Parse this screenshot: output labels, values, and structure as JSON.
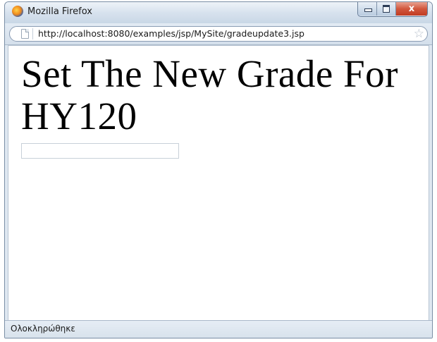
{
  "window": {
    "title": "Mozilla Firefox",
    "icon": "firefox-logo-icon",
    "controls": {
      "minimize_icon": "minimize-icon",
      "maximize_icon": "maximize-icon",
      "close_glyph": "x"
    }
  },
  "navbar": {
    "url": "http://localhost:8080/examples/jsp/MySite/gradeupdate3.jsp",
    "site_icon": "page-icon",
    "bookmark_glyph": "☆"
  },
  "page": {
    "heading": "Set The New Grade For HY120",
    "grade_input": {
      "value": "",
      "placeholder": ""
    }
  },
  "statusbar": {
    "text": "Ολοκληρώθηκε"
  },
  "colors": {
    "close_button": "#c94a30",
    "window_frame": "#dfe8f1",
    "page_background": "#ffffff"
  }
}
